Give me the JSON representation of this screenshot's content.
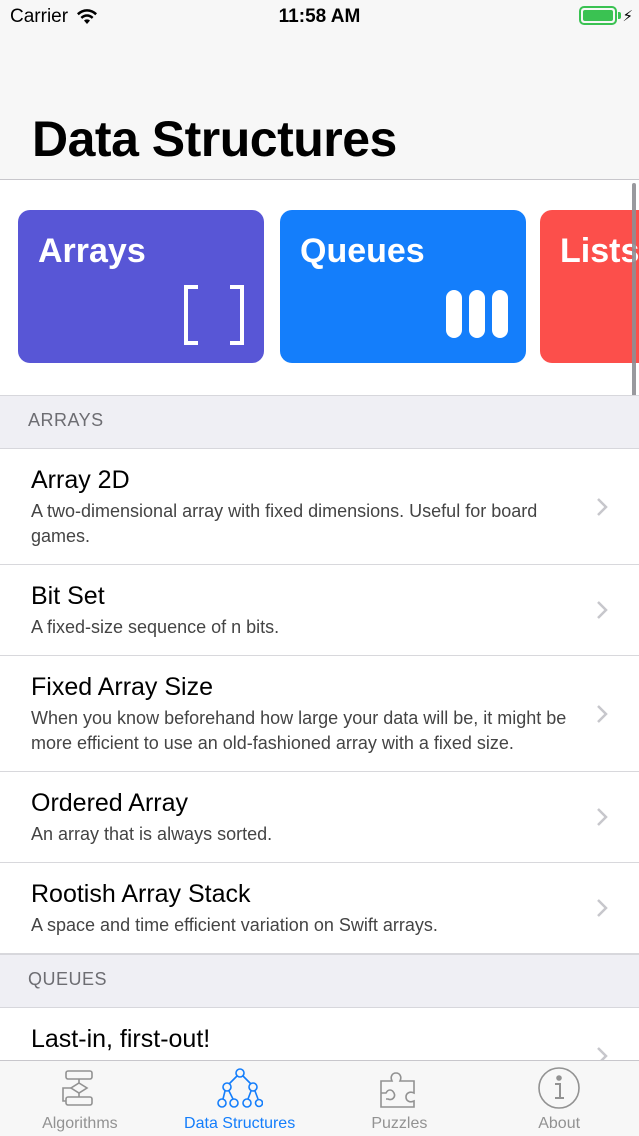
{
  "status_bar": {
    "carrier": "Carrier",
    "time": "11:58 AM",
    "battery_level": 1.0
  },
  "header": {
    "title": "Data Structures"
  },
  "cards": [
    {
      "title": "Arrays",
      "color": "#5856d6",
      "icon": "brackets-icon"
    },
    {
      "title": "Queues",
      "color": "#147efb",
      "icon": "queue-bars-icon"
    },
    {
      "title": "Lists",
      "color": "#fc4f4b",
      "icon": "list-icon"
    }
  ],
  "sections": [
    {
      "header": "ARRAYS",
      "rows": [
        {
          "title": "Array 2D",
          "subtitle": "A two-dimensional array with fixed dimensions. Useful for board games."
        },
        {
          "title": "Bit Set",
          "subtitle": "A fixed-size sequence of n bits."
        },
        {
          "title": "Fixed Array Size",
          "subtitle": "When you know beforehand how large your data will be, it might be more efficient to use an old-fashioned array with a fixed size."
        },
        {
          "title": "Ordered Array",
          "subtitle": "An array that is always sorted."
        },
        {
          "title": "Rootish Array Stack",
          "subtitle": "A space and time efficient variation on Swift arrays."
        }
      ]
    },
    {
      "header": "QUEUES",
      "rows": [
        {
          "title": "Last-in, first-out!",
          "subtitle": ""
        }
      ]
    }
  ],
  "tabs": [
    {
      "label": "Algorithms",
      "icon": "flowchart-icon",
      "active": false
    },
    {
      "label": "Data Structures",
      "icon": "tree-icon",
      "active": true
    },
    {
      "label": "Puzzles",
      "icon": "puzzle-icon",
      "active": false
    },
    {
      "label": "About",
      "icon": "info-icon",
      "active": false
    }
  ]
}
